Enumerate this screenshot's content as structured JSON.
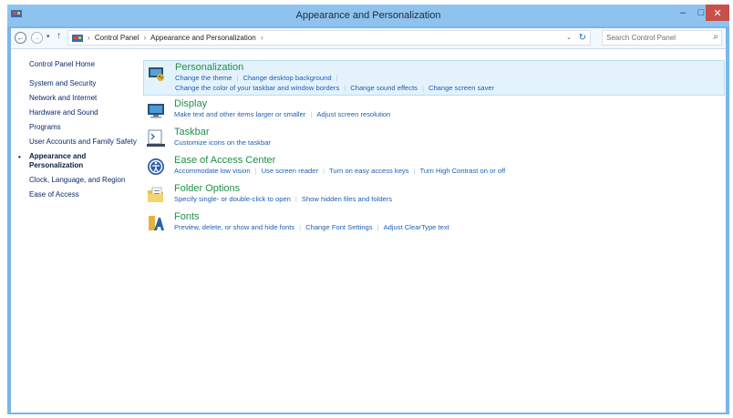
{
  "window": {
    "title": "Appearance and Personalization",
    "controls": {
      "minimize": "–",
      "maximize": "□",
      "close": "✕"
    }
  },
  "addressbar": {
    "back": "←",
    "forward": "→",
    "recent": "▾",
    "up": "↑",
    "crumbs": [
      "Control Panel",
      "Appearance and Personalization"
    ],
    "separator": "›",
    "dropdown": "⌄",
    "refresh": "↻",
    "search_placeholder": "Search Control Panel",
    "search_icon": "⌕"
  },
  "sidebar": {
    "home": "Control Panel Home",
    "items": [
      "System and Security",
      "Network and Internet",
      "Hardware and Sound",
      "Programs",
      "User Accounts and Family Safety",
      "Appearance and Personalization",
      "Clock, Language, and Region",
      "Ease of Access"
    ],
    "current_marker": "•"
  },
  "categories": [
    {
      "title": "Personalization",
      "links_line1": [
        "Change the theme",
        "Change desktop background"
      ],
      "links_line2": [
        "Change the color of your taskbar and window borders",
        "Change sound effects",
        "Change screen saver"
      ]
    },
    {
      "title": "Display",
      "links_line1": [
        "Make text and other items larger or smaller",
        "Adjust screen resolution"
      ]
    },
    {
      "title": "Taskbar",
      "links_line1": [
        "Customize icons on the taskbar"
      ]
    },
    {
      "title": "Ease of Access Center",
      "links_line1": [
        "Accommodate low vision",
        "Use screen reader",
        "Turn on easy access keys",
        "Turn High Contrast on or off"
      ]
    },
    {
      "title": "Folder Options",
      "links_line1": [
        "Specify single- or double-click to open",
        "Show hidden files and folders"
      ]
    },
    {
      "title": "Fonts",
      "links_line1": [
        "Preview, delete, or show and hide fonts",
        "Change Font Settings",
        "Adjust ClearType text"
      ]
    }
  ],
  "colors": {
    "title_green": "#1f8f4a",
    "link_blue": "#1e5fb4",
    "window_frame": "#7ab6ea",
    "close_red": "#c7504b"
  }
}
